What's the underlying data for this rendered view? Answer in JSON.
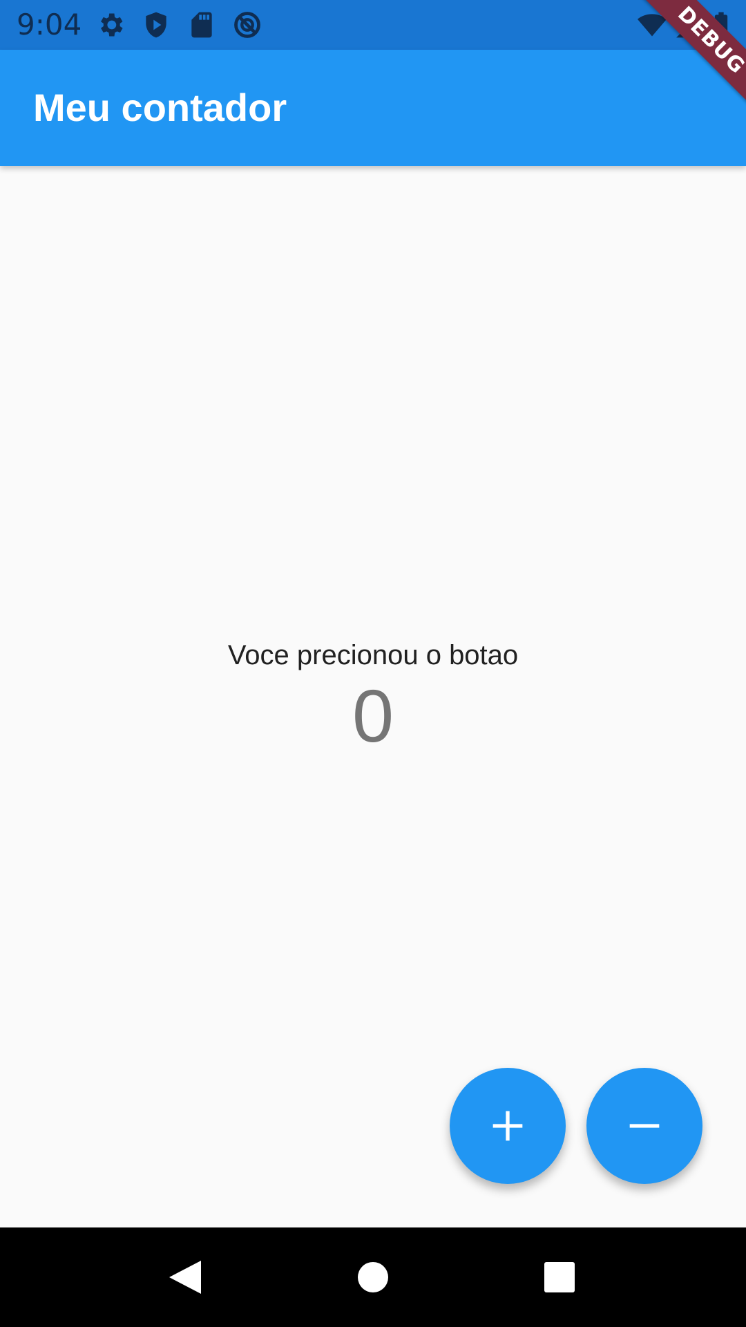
{
  "status_bar": {
    "time": "9:04",
    "icons_left": [
      "gear-icon",
      "shield-play-icon",
      "sd-card-icon",
      "no-disturb-icon"
    ],
    "icons_right": [
      "wifi-icon",
      "signal-icon",
      "battery-icon"
    ],
    "background": "#1976d2"
  },
  "app_bar": {
    "title": "Meu contador",
    "color": "#2196f3"
  },
  "debug_banner": {
    "label": "DEBUG",
    "color": "#7d2b3f"
  },
  "main": {
    "label": "Voce precionou o botao",
    "counter": "0"
  },
  "fabs": [
    {
      "action": "increment",
      "icon": "plus-icon"
    },
    {
      "action": "decrement",
      "icon": "minus-icon"
    }
  ],
  "nav_bar": {
    "buttons": [
      "back-icon",
      "home-icon",
      "recents-icon"
    ]
  }
}
